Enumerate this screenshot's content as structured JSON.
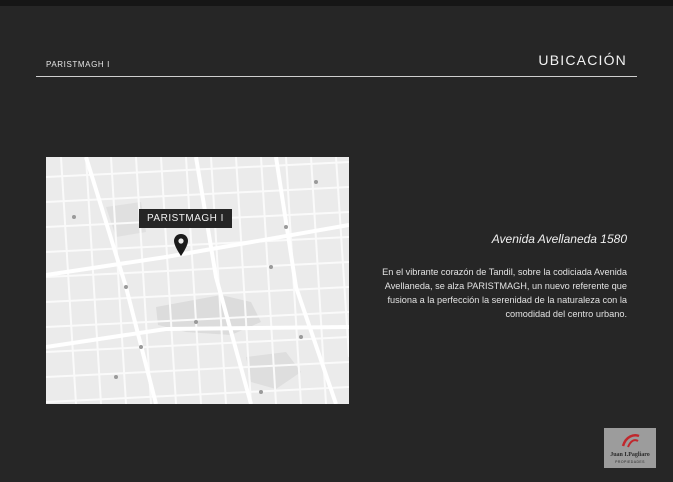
{
  "header": {
    "project_name": "PARISTMAGH I",
    "section_title": "UBICACIÓN"
  },
  "map": {
    "marker_label": "PARISTMAGH I",
    "marker_icon": "location-pin-icon"
  },
  "location": {
    "address": "Avenida Avellaneda 1580",
    "description": "En el vibrante corazón de Tandil, sobre la codiciada Avenida Avellaneda, se alza PARISTMAGH, un nuevo referente que fusiona a la perfección la serenidad de la naturaleza con la comodidad del centro urbano."
  },
  "logo": {
    "name": "Juan I.Pagliaro",
    "subtitle": "PROPIEDADES"
  },
  "colors": {
    "background": "#262626",
    "map_background": "#ebebeb",
    "accent": "#c0282d"
  }
}
